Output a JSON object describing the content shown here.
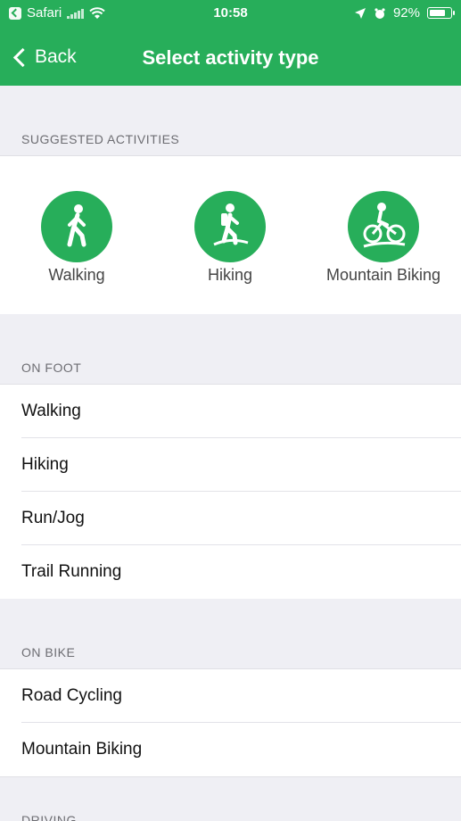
{
  "status_bar": {
    "app_back": "Safari",
    "time": "10:58",
    "battery": "92%",
    "battery_level": 0.92
  },
  "nav": {
    "back_label": "Back",
    "title": "Select activity type"
  },
  "suggested": {
    "header": "SUGGESTED ACTIVITIES",
    "items": [
      {
        "label": "Walking",
        "icon": "walking-icon"
      },
      {
        "label": "Hiking",
        "icon": "hiking-icon"
      },
      {
        "label": "Mountain Biking",
        "icon": "mountain-biking-icon"
      }
    ]
  },
  "on_foot": {
    "header": "ON FOOT",
    "items": [
      "Walking",
      "Hiking",
      "Run/Jog",
      "Trail Running"
    ]
  },
  "on_bike": {
    "header": "ON BIKE",
    "items": [
      "Road Cycling",
      "Mountain Biking"
    ]
  },
  "driving": {
    "header": "DRIVING"
  },
  "colors": {
    "brand_green": "#27ae5a",
    "background": "#efeff4"
  }
}
